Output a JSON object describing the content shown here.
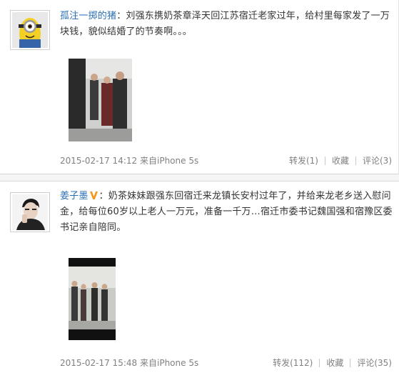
{
  "posts": [
    {
      "username": "孤注一掷的猪",
      "text": "：刘强东携奶茶章泽天回江苏宿迁老家过年，给村里每家发了一万块钱，貌似结婚了的节奏啊。。。",
      "timestamp": "2015-02-17 14:12",
      "source": "来自iPhone 5s",
      "actions": {
        "repost": "转发(1)",
        "favorite": "收藏",
        "comment": "评论(3)"
      }
    },
    {
      "username": "姜子墨",
      "text": "：奶茶妹妹跟强东回宿迁来龙镇长安村过年了，并给来龙老乡送入慰问金，给每位60岁以上老人一万元，准备一千万…宿迁市委书记魏国强和宿豫区委书记亲自陪同。",
      "timestamp": "2015-02-17 15:48",
      "source": "来自iPhone 5s",
      "actions": {
        "repost": "转发(112)",
        "favorite": "收藏",
        "comment": "评论(35)"
      }
    }
  ]
}
